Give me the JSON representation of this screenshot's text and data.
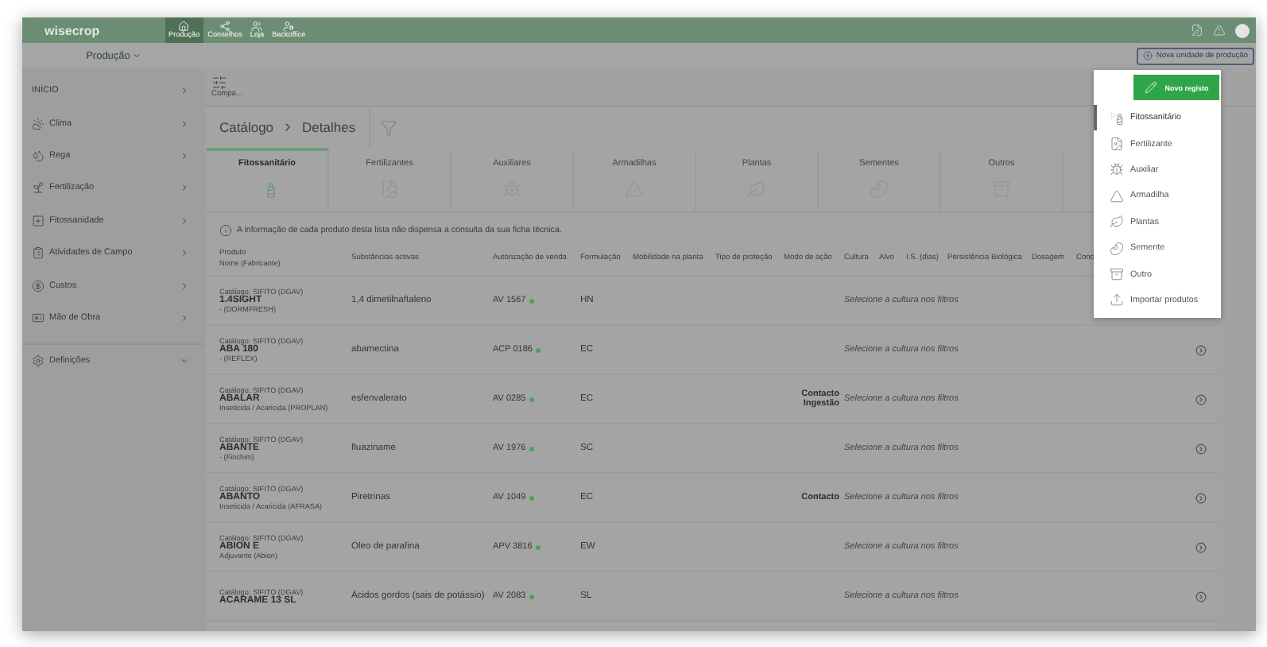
{
  "top_bar": {
    "logo": "wisecrop",
    "nav": [
      {
        "label": "Produção",
        "selected": true
      },
      {
        "label": "Conselhos",
        "selected": false
      },
      {
        "label": "Loja",
        "selected": false
      },
      {
        "label": "Backoffice",
        "selected": false
      }
    ]
  },
  "sub_bar": {
    "unit_selector": "Produção",
    "new_unit_button": "Nova unidade de produção"
  },
  "sidebar": {
    "items": [
      {
        "label": "INÍCIO",
        "kind": "link"
      },
      {
        "label": "Clima",
        "kind": "link"
      },
      {
        "label": "Rega",
        "kind": "link"
      },
      {
        "label": "Fertilização",
        "kind": "link"
      },
      {
        "label": "Fitossanidade",
        "kind": "link"
      },
      {
        "label": "Atividades de Campo",
        "kind": "link"
      },
      {
        "label": "Custos",
        "kind": "link"
      },
      {
        "label": "Mão de Obra",
        "kind": "link"
      },
      {
        "label": "Definições",
        "kind": "group"
      }
    ]
  },
  "toolbar": {
    "compare_label": "Compa..."
  },
  "catalog": {
    "breadcrumb": [
      "Catálogo",
      "Detalhes"
    ],
    "tabs": [
      {
        "label": "Fitossanitário",
        "selected": true
      },
      {
        "label": "Fertilizantes",
        "selected": false
      },
      {
        "label": "Auxiliares",
        "selected": false
      },
      {
        "label": "Armadilhas",
        "selected": false
      },
      {
        "label": "Plantas",
        "selected": false
      },
      {
        "label": "Sementes",
        "selected": false
      },
      {
        "label": "Outros",
        "selected": false
      }
    ],
    "notice": "A informação de cada produto desta lista não dispensa a consulta da sua ficha técnica.",
    "table": {
      "product_column": {
        "label": "Produto",
        "sublabel": "Nome (Fabricante)"
      },
      "columns": [
        "Substâncias activas",
        "Autorização de venda",
        "Formulação",
        "Mobilidade na planta",
        "Tipo de proteção",
        "Modo de ação",
        "Cultura",
        "Alvo",
        "I.S. (dias)",
        "Persistência Biológica",
        "Dosagem",
        "Conc"
      ],
      "rows": [
        {
          "catalog": "Catálogo: SIFITO (DGAV)",
          "name": "1.4SIGHT",
          "maker": "- (DORMFRESH)",
          "substance": "1,4 dimetilnaftaleno",
          "authorization": "AV 1567",
          "authorized": true,
          "formulation": "HN",
          "mode": "",
          "culture_hint": "Selecione a cultura nos filtros"
        },
        {
          "catalog": "Catálogo: SIFITO (DGAV)",
          "name": "ABA 180",
          "maker": "- (REFLEX)",
          "substance": "abamectina",
          "authorization": "ACP 0186",
          "authorized": true,
          "formulation": "EC",
          "mode": "",
          "culture_hint": "Selecione a cultura nos filtros"
        },
        {
          "catalog": "Catálogo: SIFITO (DGAV)",
          "name": "ABALAR",
          "maker": "Inseticida / Acaricida (PROPLAN)",
          "substance": "esfenvalerato",
          "authorization": "AV 0285",
          "authorized": true,
          "formulation": "EC",
          "mode": "Contacto Ingestão",
          "culture_hint": "Selecione a cultura nos filtros"
        },
        {
          "catalog": "Catálogo: SIFITO (DGAV)",
          "name": "ABANTE",
          "maker": "- (Finchim)",
          "substance": "fluaziname",
          "authorization": "AV 1976",
          "authorized": true,
          "formulation": "SC",
          "mode": "",
          "culture_hint": "Selecione a cultura nos filtros"
        },
        {
          "catalog": "Catálogo: SIFITO (DGAV)",
          "name": "ABANTO",
          "maker": "Inseticida / Acaricida (AFRASA)",
          "substance": "Piretrinas",
          "authorization": "AV 1049",
          "authorized": true,
          "formulation": "EC",
          "mode": "Contacto",
          "culture_hint": "Selecione a cultura nos filtros"
        },
        {
          "catalog": "Catálogo: SIFITO (DGAV)",
          "name": "ABION E",
          "maker": "Adjuvante (Abion)",
          "substance": "Óleo de parafina",
          "authorization": "APV 3816",
          "authorized": true,
          "formulation": "EW",
          "mode": "",
          "culture_hint": "Selecione a cultura nos filtros"
        },
        {
          "catalog": "Catálogo: SIFITO (DGAV)",
          "name": "ACARAME 13 SL",
          "maker": "",
          "substance": "Ácidos gordos (sais de potássio)",
          "authorization": "AV 2083",
          "authorized": true,
          "formulation": "SL",
          "mode": "",
          "culture_hint": "Selecione a cultura nos filtros"
        }
      ]
    }
  },
  "new_menu": {
    "button": "Novo registo",
    "items": [
      {
        "label": "Fitossanitário",
        "selected": true
      },
      {
        "label": "Fertilizante",
        "selected": false
      },
      {
        "label": "Auxiliar",
        "selected": false
      },
      {
        "label": "Armadilha",
        "selected": false
      },
      {
        "label": "Plantas",
        "selected": false
      },
      {
        "label": "Semente",
        "selected": false
      },
      {
        "label": "Outro",
        "selected": false
      },
      {
        "label": "Importar produtos",
        "selected": false
      }
    ]
  }
}
